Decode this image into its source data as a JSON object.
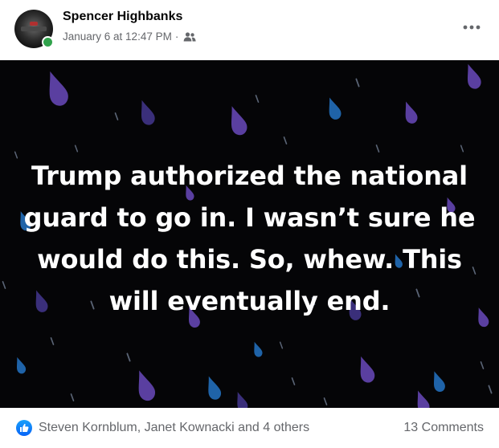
{
  "header": {
    "author": "Spencer Highbanks",
    "timestamp": "January 6 at 12:47 PM",
    "separator": "·",
    "audience_icon": "friends-icon",
    "more_icon": "more-options-icon"
  },
  "post": {
    "text": "Trump authorized the national guard to go in. I wasn’t sure he would do this. So, whew. This will eventually end.",
    "background": "#050507",
    "text_color": "#ffffff",
    "drop_colors": [
      "#3a2f7a",
      "#5a3fa0",
      "#1f63a8",
      "#5a6475"
    ]
  },
  "footer": {
    "reaction_icon": "like-icon",
    "reactors": "Steven Kornblum, Janet Kownacki and 4 others",
    "comments": "13 Comments"
  },
  "colors": {
    "online": "#31a24c",
    "like_blue": "#1877f2",
    "secondary_text": "#65676b"
  }
}
